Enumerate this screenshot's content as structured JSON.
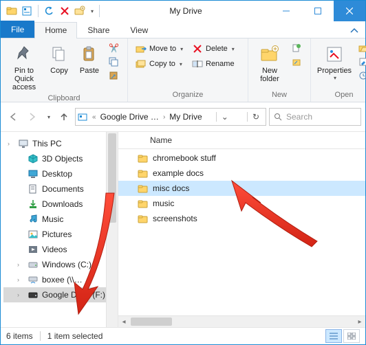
{
  "window": {
    "title": "My Drive"
  },
  "tabs": {
    "file": "File",
    "home": "Home",
    "share": "Share",
    "view": "View"
  },
  "ribbon": {
    "clipboard": {
      "pin": "Pin to Quick\naccess",
      "copy": "Copy",
      "paste": "Paste",
      "label": "Clipboard"
    },
    "organize": {
      "moveto": "Move to",
      "copyto": "Copy to",
      "delete": "Delete",
      "rename": "Rename",
      "label": "Organize"
    },
    "new": {
      "newfolder": "New\nfolder",
      "label": "New"
    },
    "open": {
      "properties": "Properties",
      "label": "Open"
    }
  },
  "breadcrumb": {
    "root": "Google Drive …",
    "current": "My Drive"
  },
  "search": {
    "placeholder": "Search"
  },
  "tree": [
    {
      "label": "This PC",
      "icon": "pc",
      "expandable": true
    },
    {
      "label": "3D Objects",
      "icon": "3d"
    },
    {
      "label": "Desktop",
      "icon": "desktop"
    },
    {
      "label": "Documents",
      "icon": "documents"
    },
    {
      "label": "Downloads",
      "icon": "downloads"
    },
    {
      "label": "Music",
      "icon": "music"
    },
    {
      "label": "Pictures",
      "icon": "pictures"
    },
    {
      "label": "Videos",
      "icon": "videos"
    },
    {
      "label": "Windows (C:)",
      "icon": "drive",
      "expandable": true
    },
    {
      "label": "boxee (\\\\…",
      "icon": "netdrive",
      "expandable": true
    },
    {
      "label": "Google Drive (F:)",
      "icon": "gdrive",
      "expandable": true,
      "selected": true
    }
  ],
  "columns": {
    "name": "Name"
  },
  "items": [
    {
      "name": "chromebook stuff"
    },
    {
      "name": "example docs"
    },
    {
      "name": "misc docs",
      "selected": true
    },
    {
      "name": "music"
    },
    {
      "name": "screenshots"
    }
  ],
  "status": {
    "count": "6 items",
    "selection": "1 item selected"
  }
}
